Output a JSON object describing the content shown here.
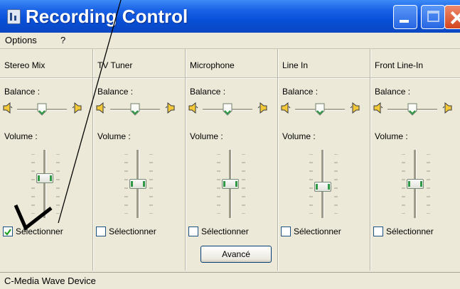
{
  "window": {
    "title": "Recording Control"
  },
  "menu": [
    "Options",
    "?"
  ],
  "channels": [
    {
      "name": "Stereo Mix",
      "balance_label": "Balance :",
      "volume_label": "Volume :",
      "volume": 0.6,
      "select_label": "Sélectionner",
      "selected": true
    },
    {
      "name": "TV Tuner",
      "balance_label": "Balance :",
      "volume_label": "Volume :",
      "volume": 0.5,
      "select_label": "Sélectionner",
      "selected": false
    },
    {
      "name": "Microphone",
      "balance_label": "Balance :",
      "volume_label": "Volume :",
      "volume": 0.5,
      "select_label": "Sélectionner",
      "selected": false
    },
    {
      "name": "Line In",
      "balance_label": "Balance :",
      "volume_label": "Volume :",
      "volume": 0.45,
      "select_label": "Sélectionner",
      "selected": false
    },
    {
      "name": "Front Line-In",
      "balance_label": "Balance :",
      "volume_label": "Volume :",
      "volume": 0.5,
      "select_label": "Sélectionner",
      "selected": false
    }
  ],
  "advanced_button": "Avancé",
  "status": "C-Media Wave Device",
  "icons": [
    "window-app-icon",
    "minimize-icon",
    "maximize-icon",
    "close-icon",
    "speaker-left-icon",
    "speaker-right-icon",
    "checkbox-check-icon"
  ],
  "colors": {
    "titlebar": "#0a4ed6",
    "face": "#ece9d8",
    "thumb_accent": "#2e9a44",
    "check": "#21a121"
  }
}
